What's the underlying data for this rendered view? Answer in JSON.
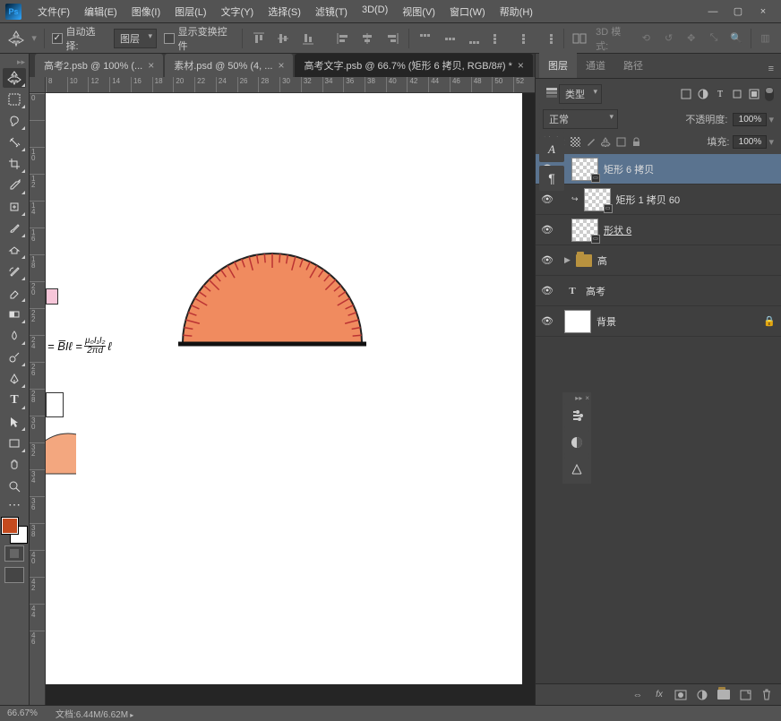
{
  "menu": {
    "items": [
      "文件(F)",
      "编辑(E)",
      "图像(I)",
      "图层(L)",
      "文字(Y)",
      "选择(S)",
      "滤镜(T)",
      "3D(D)",
      "视图(V)",
      "窗口(W)",
      "帮助(H)"
    ]
  },
  "options": {
    "auto_select": "自动选择:",
    "target": "图层",
    "show_transform": "显示变换控件",
    "mode3d_label": "3D 模式:"
  },
  "tabs": [
    {
      "label": "高考2.psb @ 100% (...",
      "active": false
    },
    {
      "label": "素材.psd @ 50% (4, ...",
      "active": false
    },
    {
      "label": "高考文字.psb @ 66.7% (矩形 6 拷贝, RGB/8#) *",
      "active": true
    }
  ],
  "ruler_h": [
    "8",
    "10",
    "12",
    "14",
    "16",
    "18",
    "20",
    "22",
    "24",
    "26",
    "28",
    "30",
    "32",
    "34",
    "36",
    "38",
    "40",
    "42",
    "44",
    "46",
    "48",
    "50",
    "52"
  ],
  "ruler_v": [
    "0",
    "",
    "1\n0",
    "1\n2",
    "1\n4",
    "1\n6",
    "1\n8",
    "2\n0",
    "2\n2",
    "2\n4",
    "2\n6",
    "2\n8",
    "3\n0",
    "3\n2",
    "3\n4",
    "3\n6",
    "3\n8",
    "4\n0",
    "4\n2",
    "4\n4",
    "4\n6"
  ],
  "formula": {
    "prefix": "= B̅Iℓ =",
    "num": "µ₀I₁I₂",
    "den": "2πd",
    "suffix": "ℓ"
  },
  "layers_panel": {
    "tabs": [
      "图层",
      "通道",
      "路径"
    ],
    "kind_label": "类型",
    "blend_mode": "正常",
    "opacity_label": "不透明度:",
    "opacity_value": "100%",
    "lock_label": "锁定:",
    "fill_label": "填充:",
    "fill_value": "100%",
    "layers": [
      {
        "name": "矩形 6 拷贝",
        "type": "shape",
        "selected": true
      },
      {
        "name": "矩形 1 拷贝 60",
        "type": "shape",
        "linked": true
      },
      {
        "name": "形状 6",
        "type": "shape",
        "smart": true,
        "underline": true
      },
      {
        "name": "高",
        "type": "group"
      },
      {
        "name": "高考",
        "type": "text"
      },
      {
        "name": "背景",
        "type": "bg",
        "locked": true
      }
    ]
  },
  "status": {
    "zoom": "66.67%",
    "doc_label": "文档:",
    "doc_size": "6.44M/6.62M"
  }
}
